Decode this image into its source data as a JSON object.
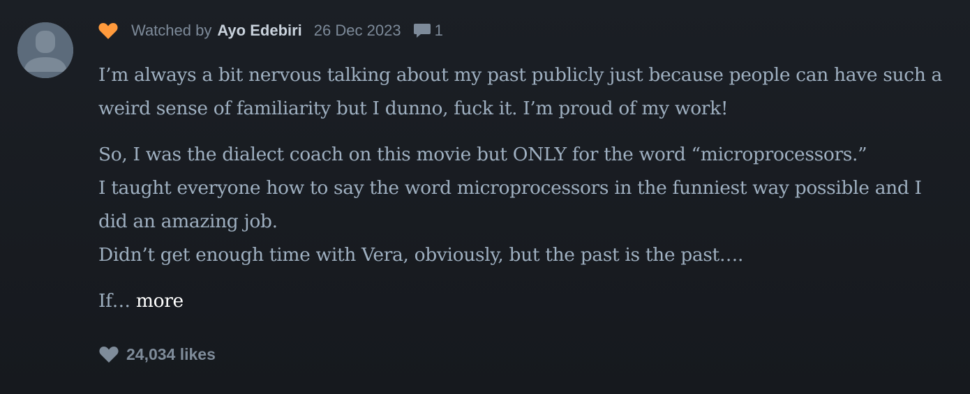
{
  "review": {
    "watched_label": "Watched by",
    "author": "Ayo Edebiri",
    "date": "26 Dec 2023",
    "comment_count": "1",
    "liked_color": "#ff9a3c",
    "icons": {
      "liked": "heart-icon",
      "comments": "comment-bubble-icon",
      "likes": "heart-icon",
      "avatar": "default-avatar-icon"
    },
    "paragraphs": [
      "I’m always a bit nervous talking about my past publicly just because people can have such a weird sense of familiarity but I dunno, fuck it. I’m proud of my work!",
      "So, I was the dialect coach on this movie but ONLY for the word “microprocessors.”",
      "I taught everyone how to say the word microprocessors in the funniest way possible and I did an amazing job.",
      "Didn’t get enough time with Vera, obviously, but the past is the past…."
    ],
    "truncated_text": "If…",
    "more_label": "more",
    "likes_label": "24,034 likes"
  }
}
